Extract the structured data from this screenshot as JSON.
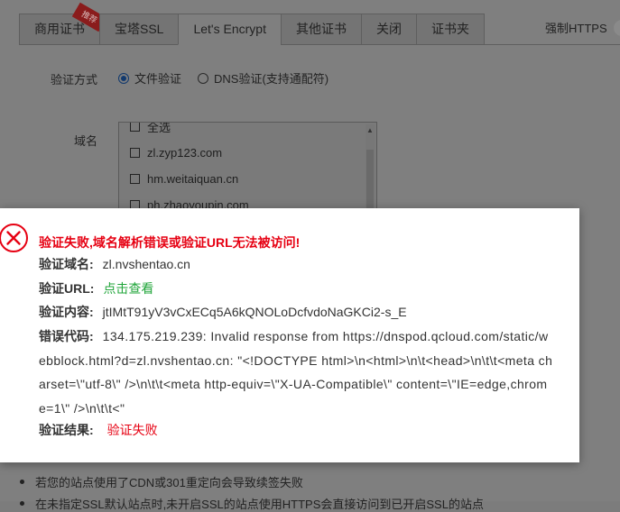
{
  "tabs": [
    {
      "label": "商用证书",
      "badge": "推荐"
    },
    {
      "label": "宝塔SSL"
    },
    {
      "label": "Let's Encrypt",
      "active": true
    },
    {
      "label": "其他证书"
    },
    {
      "label": "关闭"
    },
    {
      "label": "证书夹"
    }
  ],
  "force_https_label": "强制HTTPS",
  "verify_method": {
    "label": "验证方式",
    "options": [
      {
        "label": "文件验证",
        "selected": true
      },
      {
        "label": "DNS验证(支持通配符)",
        "selected": false
      }
    ]
  },
  "domain": {
    "label": "域名",
    "items": [
      {
        "label": "全选"
      },
      {
        "label": "zl.zyp123.com"
      },
      {
        "label": "hm.weitaiquan.cn"
      },
      {
        "label": "ph.zhaoyoupin.com"
      }
    ]
  },
  "notes": [
    "若您的站点使用了CDN或301重定向会导致续签失败",
    "在未指定SSL默认站点时,未开启SSL的站点使用HTTPS会直接访问到已开启SSL的站点"
  ],
  "error_popup": {
    "title": "验证失败,域名解析错误或验证URL无法被访问!",
    "domain_label": "验证域名:",
    "domain_value": "zl.nvshentao.cn",
    "url_label": "验证URL:",
    "url_link": "点击查看",
    "content_label": "验证内容:",
    "content_value": "jtIMtT91yV3vCxECq5A6kQNOLoDcfvdoNaGKCi2-s_E",
    "code_label": "错误代码:",
    "code_value": "134.175.219.239: Invalid response from https://dnspod.qcloud.com/static/webblock.html?d=zl.nvshentao.cn: \"<!DOCTYPE html>\\n<html>\\n\\t<head>\\n\\t\\t<meta charset=\\\"utf-8\\\" />\\n\\t\\t<meta http-equiv=\\\"X-UA-Compatible\\\" content=\\\"IE=edge,chrome=1\\\" />\\n\\t\\t<\"",
    "result_label": "验证结果:",
    "result_value": "验证失败",
    "colors": {
      "error": "#e60012",
      "link": "#20a53a"
    }
  }
}
